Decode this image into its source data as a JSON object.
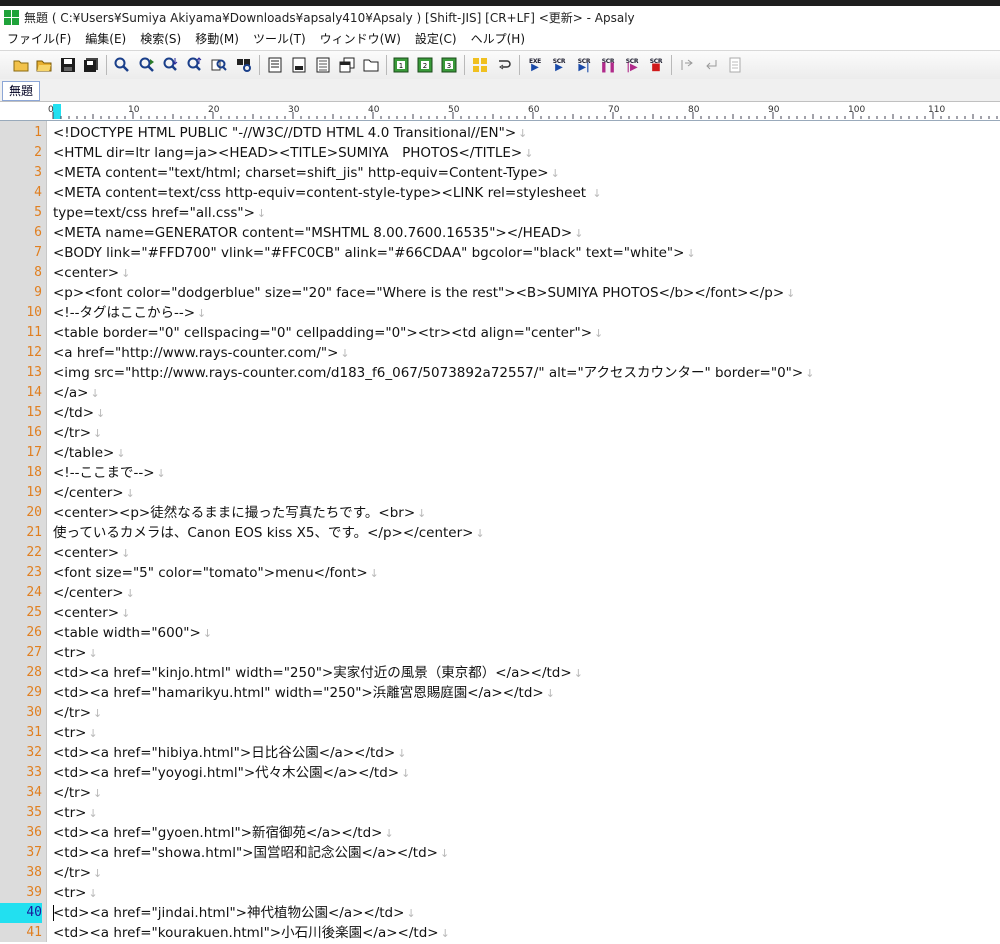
{
  "window": {
    "title": "無題 ( C:¥Users¥Sumiya Akiyama¥Downloads¥apsaly410¥Apsaly ) [Shift-JIS] [CR+LF] <更新> - Apsaly"
  },
  "menu": [
    "ファイル(F)",
    "編集(E)",
    "検索(S)",
    "移動(M)",
    "ツール(T)",
    "ウィンドウ(W)",
    "設定(C)",
    "ヘルプ(H)"
  ],
  "toolbar": {
    "exec_labels": [
      "EXE",
      "SCR",
      "SCR",
      "SCR",
      "SCR",
      "SCR"
    ]
  },
  "tabs": [
    "無題"
  ],
  "ruler": {
    "labels": [
      "0",
      "10",
      "20",
      "30",
      "40",
      "50",
      "60",
      "70",
      "80",
      "90",
      "100",
      "110"
    ]
  },
  "editor": {
    "current_line": 40,
    "eol_mark": "↓",
    "lines": [
      "<!DOCTYPE HTML PUBLIC \"-//W3C//DTD HTML 4.0 Transitional//EN\">",
      "<HTML dir=ltr lang=ja><HEAD><TITLE>SUMIYA　PHOTOS</TITLE>",
      "<META content=\"text/html; charset=shift_jis\" http-equiv=Content-Type>",
      "<META content=text/css http-equiv=content-style-type><LINK rel=stylesheet ",
      "type=text/css href=\"all.css\">",
      "<META name=GENERATOR content=\"MSHTML 8.00.7600.16535\"></HEAD>",
      "<BODY link=\"#FFD700\" vlink=\"#FFC0CB\" alink=\"#66CDAA\" bgcolor=\"black\" text=\"white\">",
      "<center>",
      "<p><font color=\"dodgerblue\" size=\"20\" face=\"Where is the rest\"><B>SUMIYA PHOTOS</b></font></p>",
      "<!--タグはここから-->",
      "<table border=\"0\" cellspacing=\"0\" cellpadding=\"0\"><tr><td align=\"center\">",
      "<a href=\"http://www.rays-counter.com/\">",
      "<img src=\"http://www.rays-counter.com/d183_f6_067/5073892a72557/\" alt=\"アクセスカウンター\" border=\"0\">",
      "</a>",
      "</td>",
      "</tr>",
      "</table>",
      "<!--ここまで-->",
      "</center>",
      "<center><p>徒然なるままに撮った写真たちです。<br>",
      "使っているカメラは、Canon EOS kiss X5、です。</p></center>",
      "<center>",
      "<font size=\"5\" color=\"tomato\">menu</font>",
      "</center>",
      "<center>",
      "<table width=\"600\">",
      "<tr>",
      "<td><a href=\"kinjo.html\" width=\"250\">実家付近の風景（東京都）</a></td>",
      "<td><a href=\"hamarikyu.html\" width=\"250\">浜離宮恩賜庭園</a></td>",
      "</tr>",
      "<tr>",
      "<td><a href=\"hibiya.html\">日比谷公園</a></td>",
      "<td><a href=\"yoyogi.html\">代々木公園</a></td>",
      "</tr>",
      "<tr>",
      "<td><a href=\"gyoen.html\">新宿御苑</a></td>",
      "<td><a href=\"showa.html\">国営昭和記念公園</a></td>",
      "</tr>",
      "<tr>",
      "<td><a href=\"jindai.html\">神代植物公園</a></td>",
      "<td><a href=\"kourakuen.html\">小石川後楽園</a></td>"
    ]
  },
  "colors": {
    "line_number": "#e07f20",
    "current_line_highlight": "#22e0f0",
    "gutter_bg": "#dcdcdc"
  }
}
